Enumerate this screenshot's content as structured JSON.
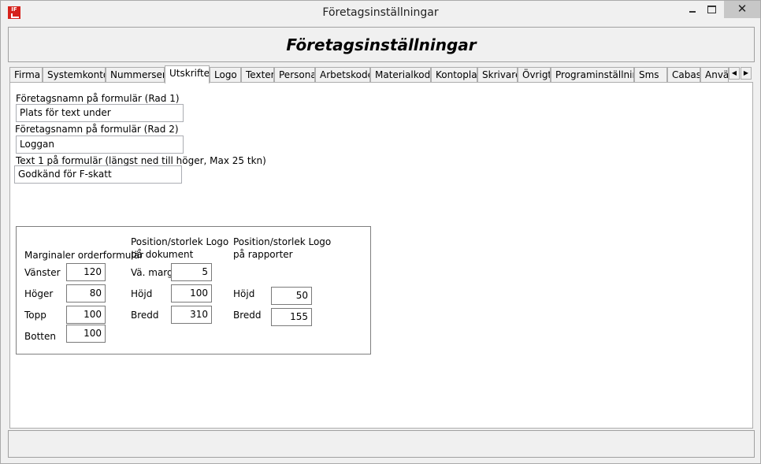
{
  "window": {
    "title": "Företagsinställningar"
  },
  "header": {
    "title": "Företagsinställningar"
  },
  "tabs": [
    {
      "label": "Firma"
    },
    {
      "label": "Systemkonton"
    },
    {
      "label": "Nummerserier"
    },
    {
      "label": "Utskrifter"
    },
    {
      "label": "Logo"
    },
    {
      "label": "Texter"
    },
    {
      "label": "Personal"
    },
    {
      "label": "Arbetskoder"
    },
    {
      "label": "Materialkoder"
    },
    {
      "label": "Kontoplan"
    },
    {
      "label": "Skrivare"
    },
    {
      "label": "Övrigt"
    },
    {
      "label": "Programinställningar"
    },
    {
      "label": "Sms"
    },
    {
      "label": "Cabas"
    },
    {
      "label": "Anvä"
    }
  ],
  "active_tab": "Utskrifter",
  "form": {
    "row1_label": "Företagsnamn på formulär (Rad 1)",
    "row1_value": "Plats för text under",
    "row2_label": "Företagsnamn på formulär (Rad 2)",
    "row2_value": "Loggan",
    "text1_label": "Text 1 på formulär (längst ned till höger, Max 25 tkn)",
    "text1_value": "Godkänd för F-skatt"
  },
  "margins": {
    "heading": "Marginaler orderformulär",
    "left_label": "Vänster",
    "left_value": "120",
    "right_label": "Höger",
    "right_value": "80",
    "top_label": "Topp",
    "top_value": "100",
    "bottom_label": "Botten",
    "bottom_value": "100"
  },
  "logo_document": {
    "heading_line1": "Position/storlek  Logo",
    "heading_line2": "på dokument",
    "margin_label": "Vä. marg",
    "margin_value": "5",
    "height_label": "Höjd",
    "height_value": "100",
    "width_label": "Bredd",
    "width_value": "310"
  },
  "logo_reports": {
    "heading_line1": "Position/storlek  Logo",
    "heading_line2": "på rapporter",
    "height_label": "Höjd",
    "height_value": "50",
    "width_label": "Bredd",
    "width_value": "155"
  },
  "icons": {
    "app": "app-logo-icon",
    "minimize": "minimize-icon",
    "maximize": "maximize-icon",
    "close": "close-icon",
    "tab_left": "arrow-left-icon",
    "tab_right": "arrow-right-icon"
  },
  "glyphs": {
    "close": "✕",
    "left": "◀",
    "right": "▶",
    "app": "IF"
  }
}
